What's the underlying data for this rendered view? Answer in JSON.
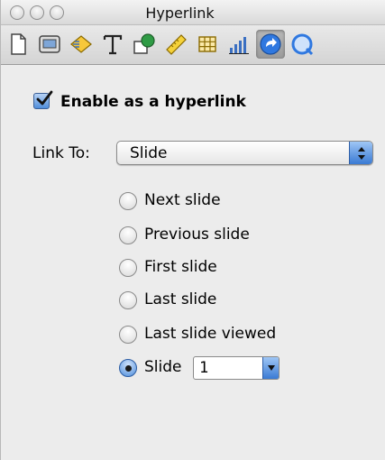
{
  "window": {
    "title": "Hyperlink",
    "buttons": [
      "close-button",
      "minimize-button",
      "zoom-button"
    ]
  },
  "toolbar": {
    "items": [
      {
        "name": "document-inspector",
        "icon": "document-icon"
      },
      {
        "name": "slide-inspector",
        "icon": "slide-icon"
      },
      {
        "name": "build-inspector",
        "icon": "build-icon"
      },
      {
        "name": "text-inspector",
        "icon": "text-T-icon"
      },
      {
        "name": "graphic-inspector",
        "icon": "graphic-icon"
      },
      {
        "name": "metrics-inspector",
        "icon": "ruler-icon"
      },
      {
        "name": "table-inspector",
        "icon": "table-icon"
      },
      {
        "name": "chart-inspector",
        "icon": "bar-chart-icon"
      },
      {
        "name": "hyperlink-inspector",
        "icon": "hyperlink-arrow-icon",
        "active": true
      },
      {
        "name": "quicktime-inspector",
        "icon": "quicktime-icon"
      }
    ]
  },
  "panel": {
    "enable_label": "Enable as a hyperlink",
    "enable_checked": true,
    "link_to_label": "Link To:",
    "link_to_value": "Slide",
    "options": [
      {
        "label": "Next slide",
        "selected": false
      },
      {
        "label": "Previous slide",
        "selected": false
      },
      {
        "label": "First slide",
        "selected": false
      },
      {
        "label": "Last slide",
        "selected": false
      },
      {
        "label": "Last slide viewed",
        "selected": false
      },
      {
        "label": "Slide",
        "selected": true
      }
    ],
    "slide_number": "1"
  },
  "colors": {
    "accent": "#4f8edb",
    "background": "#ececec"
  }
}
